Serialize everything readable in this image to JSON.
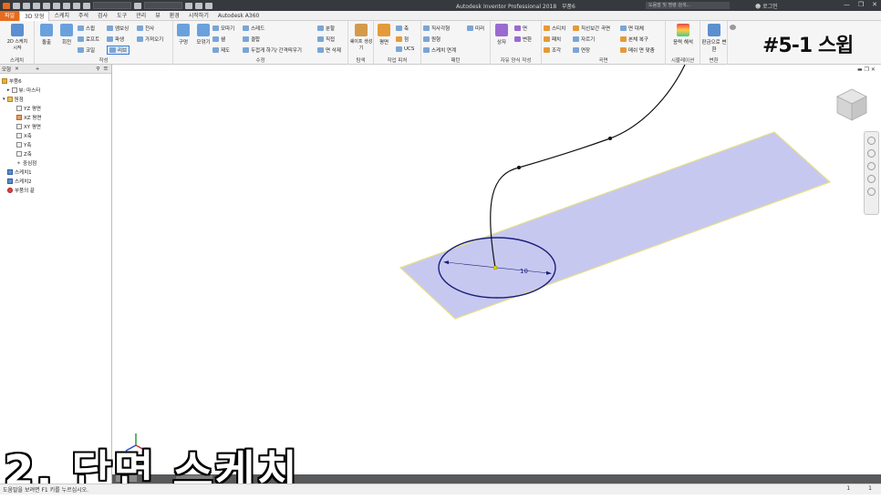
{
  "window": {
    "title": "Autodesk Inventor Professional 2018",
    "doc_name": "부품6",
    "search_placeholder": "도움말 및 명령 검색...",
    "login": "로그인"
  },
  "tabs": [
    "파일",
    "3D 모형",
    "스케치",
    "주석",
    "검사",
    "도구",
    "관리",
    "뷰",
    "환경",
    "시작하기",
    "Autodesk A360"
  ],
  "active_tab": "3D 모형",
  "ribbon": {
    "sketch_panel": {
      "label": "스케치",
      "btn": "2D 스케치\n시작"
    },
    "create_panel": {
      "label": "작성",
      "items": [
        "돌출",
        "회전",
        "스윕",
        "로프트",
        "코일",
        "엠보싱",
        "파생",
        "리브",
        "전사",
        "가져오기"
      ]
    },
    "modify_panel": {
      "label": "수정",
      "items": [
        "구멍",
        "모깎기",
        "모따기",
        "쉘",
        "제도",
        "스레드",
        "결합",
        "두껍게 하기/ 간격띄우기",
        "분할",
        "직접",
        "면 삭제"
      ]
    },
    "explore_panel": {
      "label": "탐색",
      "items": [
        "쉐이프 생성기"
      ]
    },
    "work_features": {
      "label": "작업 피처",
      "items": [
        "평면",
        "축",
        "점",
        "UCS"
      ]
    },
    "pattern_panel": {
      "label": "패턴",
      "items": [
        "직사각형",
        "원형",
        "스케치 연계",
        "미러"
      ]
    },
    "freeform_panel": {
      "label": "자유 양식 작성",
      "items": [
        "상자",
        "면",
        "변환"
      ]
    },
    "surface_panel": {
      "label": "곡면",
      "items": [
        "스티치",
        "패치",
        "조각",
        "직선보간 곡면",
        "자르기",
        "연장",
        "면 대체",
        "본체 복구",
        "메쉬 면 맞춤"
      ]
    },
    "simulation_panel": {
      "label": "시뮬레이션",
      "items": [
        "응력 해석"
      ]
    },
    "convert_panel": {
      "label": "변환",
      "items": [
        "판금으로 변환"
      ]
    }
  },
  "overlay_title": "#5-1 스윕",
  "browser": {
    "tabs": [
      "모형",
      "+"
    ],
    "tree": [
      {
        "label": "부품6",
        "depth": 0
      },
      {
        "label": "뷰: 마스터",
        "depth": 1
      },
      {
        "label": "원점",
        "depth": 1
      },
      {
        "label": "YZ 평면",
        "depth": 2
      },
      {
        "label": "XZ 평면",
        "depth": 2
      },
      {
        "label": "XY 평면",
        "depth": 2
      },
      {
        "label": "X축",
        "depth": 2
      },
      {
        "label": "Y축",
        "depth": 2
      },
      {
        "label": "Z축",
        "depth": 2
      },
      {
        "label": "중심점",
        "depth": 2
      },
      {
        "label": "스케치1",
        "depth": 1
      },
      {
        "label": "스케치2",
        "depth": 1
      },
      {
        "label": "부품의 끝",
        "depth": 1
      }
    ]
  },
  "viewport": {
    "dimension_label": "10",
    "plane_color": "#c6c8f0",
    "plane_edge_color": "#e6e08a",
    "curve_color": "#111111",
    "circle_color": "#1a1f7a"
  },
  "caption": "2. 단면 스케치",
  "status": {
    "text": "도움말을 보려면 F1 키를 누르십시오.",
    "right_a": "1",
    "right_b": "1"
  }
}
